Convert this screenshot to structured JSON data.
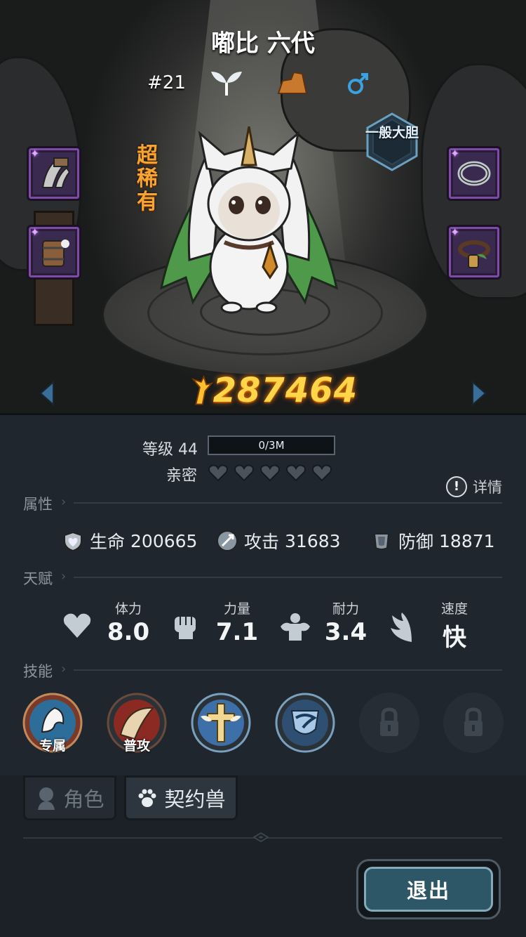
{
  "pet": {
    "name": "嘟比 六代",
    "number": "#21",
    "element_icon": "sprout-icon",
    "terrain_icon": "rock-icon",
    "gender_icon": "male-icon",
    "rarity": "超稀有",
    "temperament": "一般大胆",
    "power": "287464"
  },
  "equipment": {
    "left": [
      {
        "name": "claw-equipment-icon"
      },
      {
        "name": "barrel-equipment-icon"
      }
    ],
    "right": [
      {
        "name": "ring-equipment-icon"
      },
      {
        "name": "collar-equipment-icon"
      }
    ]
  },
  "level": {
    "label": "等级 44",
    "exp_text": "0/3M",
    "exp_fraction": 0.0
  },
  "intimacy": {
    "label": "亲密",
    "filled": 0,
    "total": 5
  },
  "detail_label": "详情",
  "sections": {
    "attributes": "属性",
    "talents": "天赋",
    "skills": "技能"
  },
  "attributes": [
    {
      "label": "生命",
      "value": "200665",
      "icon": "heart-shield-icon"
    },
    {
      "label": "攻击",
      "value": "31683",
      "icon": "sword-icon"
    },
    {
      "label": "防御",
      "value": "18871",
      "icon": "armor-icon"
    }
  ],
  "talents": [
    {
      "label": "体力",
      "value": "8.0",
      "icon": "heart-icon"
    },
    {
      "label": "力量",
      "value": "7.1",
      "icon": "fist-icon"
    },
    {
      "label": "耐力",
      "value": "3.4",
      "icon": "muscle-icon"
    },
    {
      "label": "速度",
      "value": "快",
      "icon": "wing-icon"
    }
  ],
  "skills": [
    {
      "badge": "专属",
      "icon": "exclusive-skill-icon",
      "locked": false
    },
    {
      "badge": "普攻",
      "icon": "basic-attack-icon",
      "locked": false
    },
    {
      "badge": "",
      "icon": "holy-cross-skill-icon",
      "locked": false
    },
    {
      "badge": "",
      "icon": "wind-shield-skill-icon",
      "locked": false
    },
    {
      "badge": "",
      "icon": "lock-icon",
      "locked": true
    },
    {
      "badge": "",
      "icon": "lock-icon",
      "locked": true
    }
  ],
  "tabs": [
    {
      "label": "角色",
      "icon": "character-icon"
    },
    {
      "label": "契约兽",
      "icon": "paw-icon"
    }
  ],
  "exit_label": "退出",
  "colors": {
    "rarity": "#f6a531",
    "power": "#ffd54a",
    "equipment_frame": "#7c4ca6",
    "exit_button": "#2d5767"
  }
}
